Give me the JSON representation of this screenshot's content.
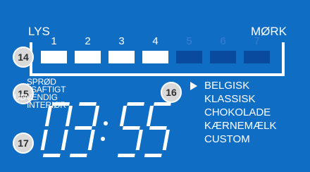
{
  "scale": {
    "left_label": "LYS",
    "right_label": "MØRK",
    "levels": [
      "1",
      "2",
      "3",
      "4",
      "5",
      "6",
      "7"
    ],
    "selected_level": 4
  },
  "badges": {
    "shade": "14",
    "texture": "15",
    "recipe": "16",
    "timer": "17"
  },
  "texture_options": [
    "SPRØD",
    "SAFTIGT",
    "UDVENDIG",
    "INTERIØR"
  ],
  "timer": {
    "display": "03:55"
  },
  "recipes": {
    "selected_index": 0,
    "items": [
      "BELGISK",
      "KLASSISK",
      "CHOKOLADE",
      "KÆRNEMÆLK",
      "CUSTOM"
    ]
  },
  "colors": {
    "background": "#0f6ec4",
    "active": "#ffffff",
    "inactive_bar": "#0a4a9e",
    "badge": "#d9d9d9"
  }
}
